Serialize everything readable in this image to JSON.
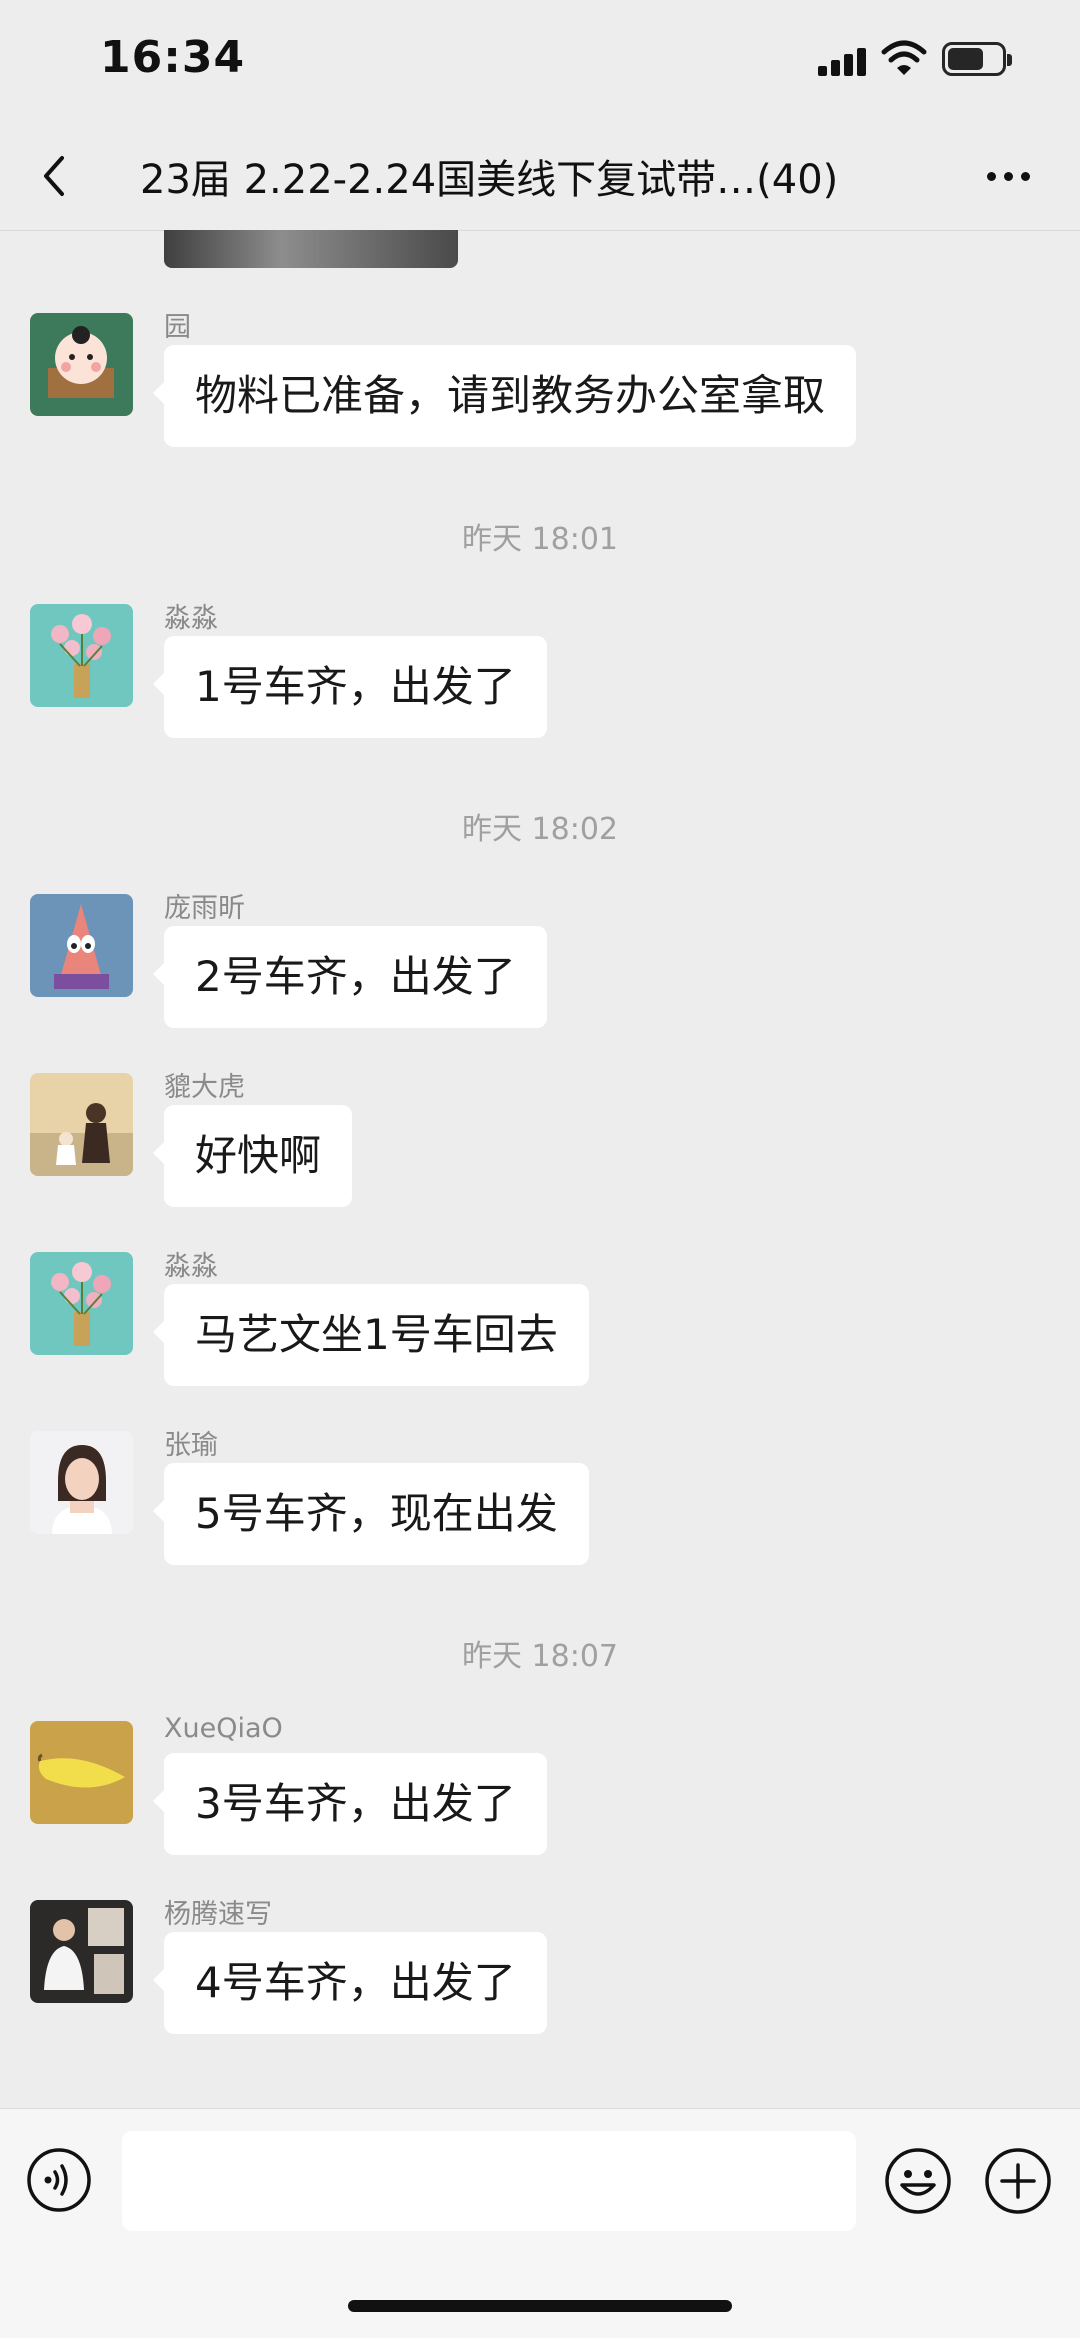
{
  "status_bar": {
    "time": "16:34"
  },
  "header": {
    "title": "23届 2.22-2.24国美线下复试带…(40)"
  },
  "timestamps": [
    "昨天 18:01",
    "昨天 18:02",
    "昨天 18:07"
  ],
  "messages": [
    {
      "sender": "园",
      "text": "物料已准备，请到教务办公室拿取"
    },
    {
      "sender": "淼淼",
      "text": "1号车齐，出发了"
    },
    {
      "sender": "庞雨昕",
      "text": "2号车齐，出发了"
    },
    {
      "sender": "貔大虎",
      "text": "好快啊"
    },
    {
      "sender": "淼淼",
      "text": "马艺文坐1号车回去"
    },
    {
      "sender": "张瑜",
      "text": "5号车齐，现在出发"
    },
    {
      "sender": "XueQiaO",
      "text": "3号车齐，出发了"
    },
    {
      "sender": "杨腾速写",
      "text": "4号车齐，出发了"
    }
  ],
  "input": {
    "value": "",
    "placeholder": ""
  },
  "icons": {
    "back": "chevron-left-icon",
    "more": "more-dots-icon",
    "voice": "voice-icon",
    "emoji": "emoji-icon",
    "add": "plus-icon"
  },
  "colors": {
    "background": "#ededed",
    "bubble": "#ffffff",
    "input_bar": "#f6f6f6"
  }
}
